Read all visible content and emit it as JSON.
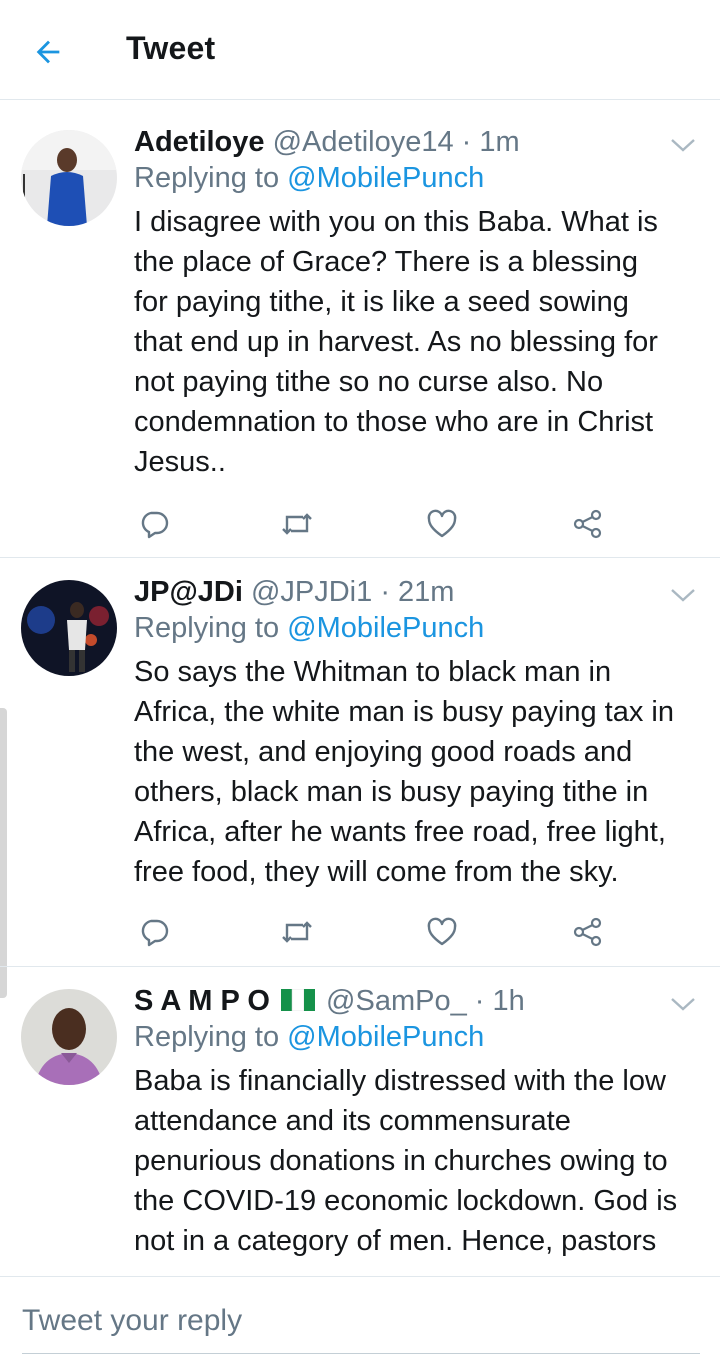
{
  "header": {
    "title": "Tweet",
    "back_icon": "arrow-left-icon"
  },
  "colors": {
    "accent": "#1b95e0",
    "text": "#14171a",
    "muted": "#657786",
    "divider": "#e1e8ed"
  },
  "tweets": [
    {
      "name": "Adetiloye",
      "handle": "@Adetiloye14",
      "time": "1m",
      "replying_prefix": "Replying to",
      "replying_handle": "@MobilePunch",
      "lines": [
        "I disagree with you on this Baba. What is",
        "the place of Grace? There is a blessing",
        "for paying tithe, it is like a seed sowing",
        "that end up in harvest. As no blessing for",
        "not paying tithe so no curse also. No",
        "condemnation to those who are in Christ",
        "Jesus.."
      ]
    },
    {
      "name": "JP@JDi",
      "handle": "@JPJDi1",
      "time": "21m",
      "replying_prefix": "Replying to",
      "replying_handle": "@MobilePunch",
      "lines": [
        "So says the Whitman to black man in",
        "Africa, the white man is busy paying tax in",
        "the west, and enjoying good roads and",
        "others, black man is busy paying tithe in",
        "Africa, after he wants free road, free light,",
        "free food, they will come from the sky."
      ]
    },
    {
      "name": "S A M P O",
      "name_flag": "nigeria-flag-icon",
      "handle": "@SamPo_",
      "time": "1h",
      "replying_prefix": "Replying to",
      "replying_handle": "@MobilePunch",
      "lines": [
        "Baba is financially distressed with the low",
        "attendance and its commensurate",
        "penurious donations in churches owing to",
        "the COVID-19 economic lockdown. God is",
        "not in a category of men. Hence, pastors"
      ]
    }
  ],
  "composer": {
    "placeholder": "Tweet your reply"
  }
}
